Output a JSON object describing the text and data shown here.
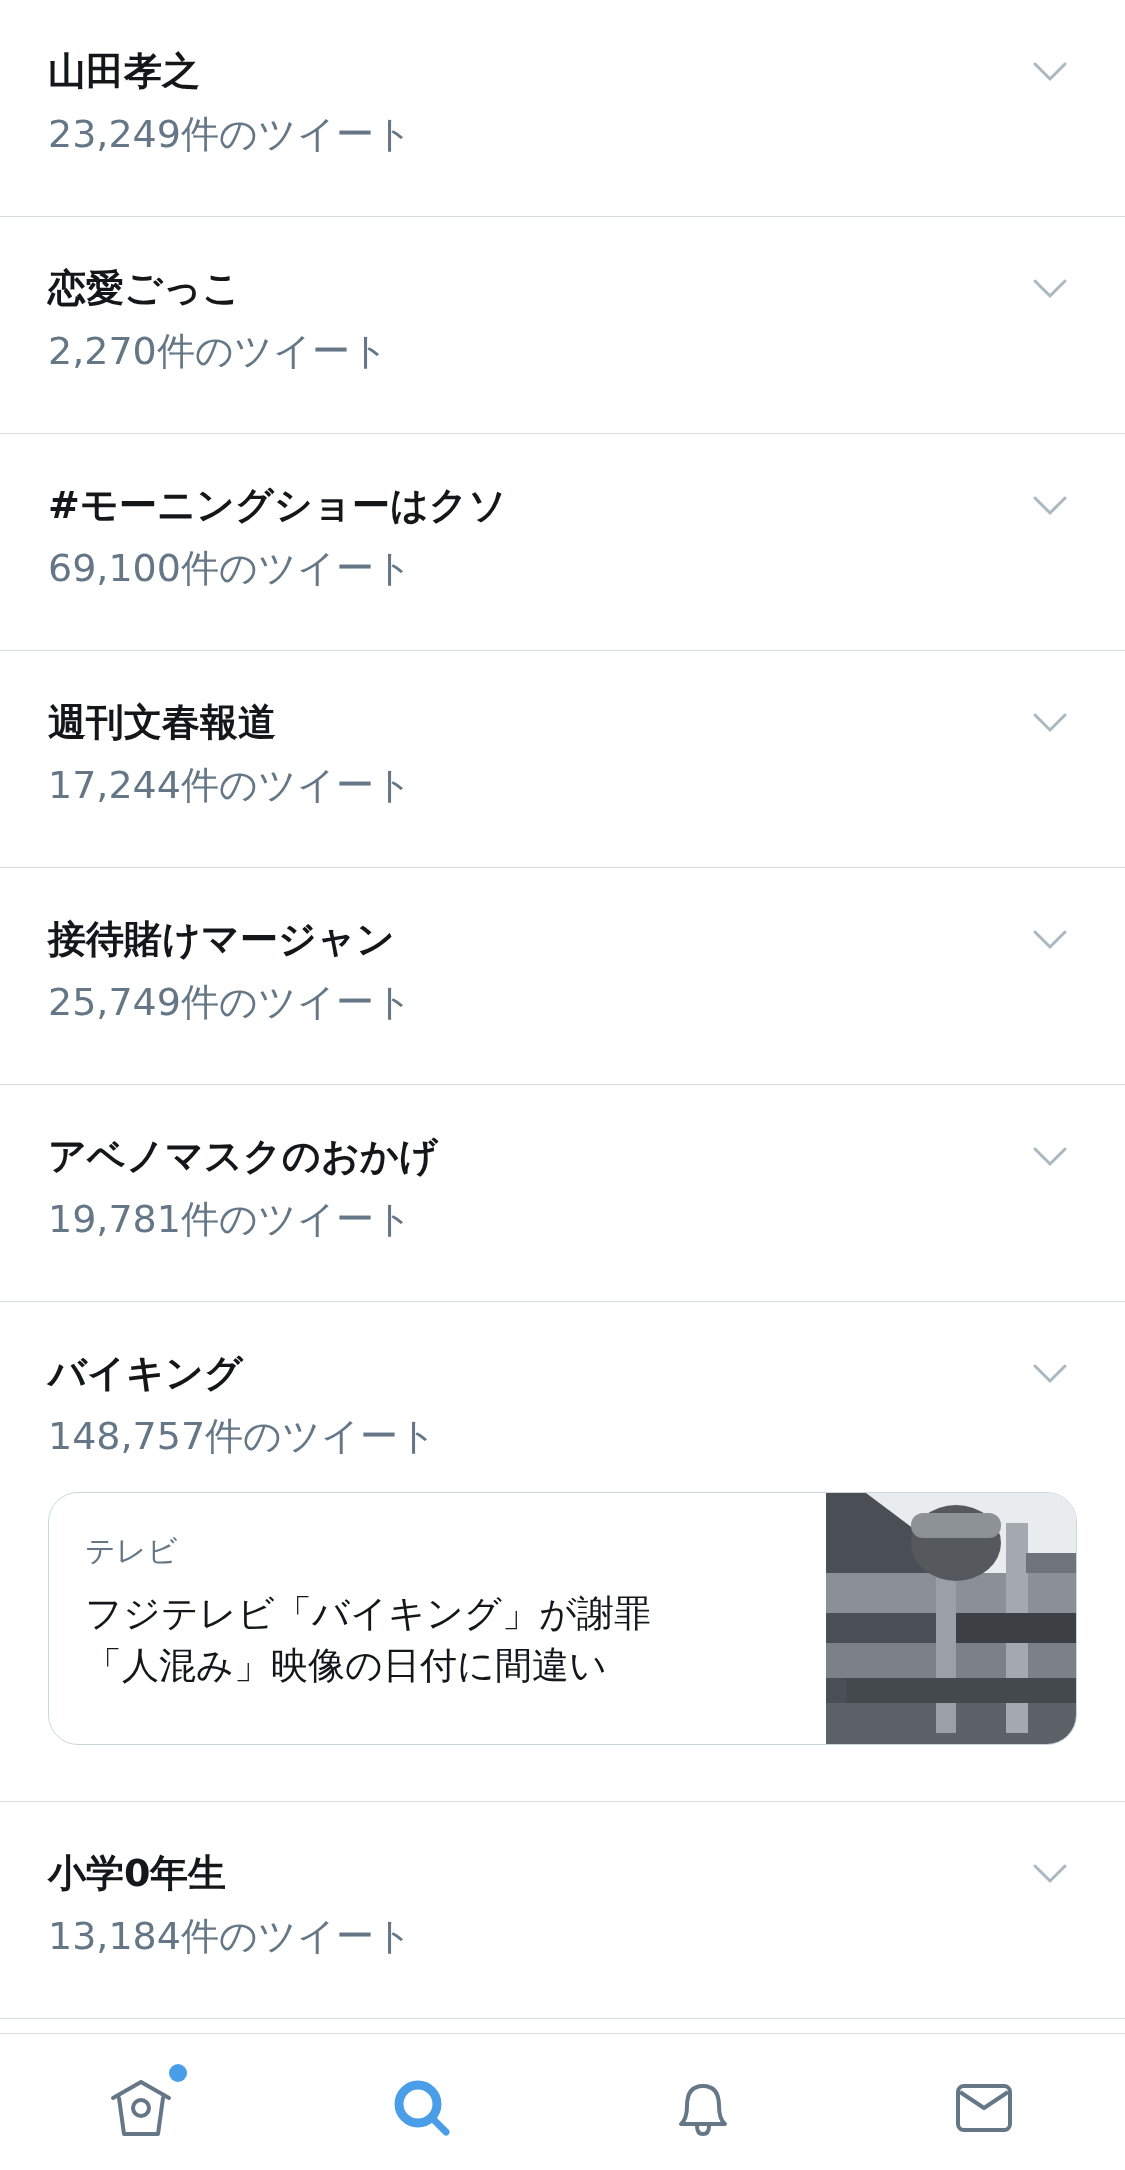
{
  "trends": [
    {
      "title": "山田孝之",
      "count": "23,249件のツイート"
    },
    {
      "title": "恋愛ごっこ",
      "count": "2,270件のツイート"
    },
    {
      "title": "#モーニングショーはクソ",
      "count": "69,100件のツイート"
    },
    {
      "title": "週刊文春報道",
      "count": "17,244件のツイート"
    },
    {
      "title": "接待賭けマージャン",
      "count": "25,749件のツイート"
    },
    {
      "title": "アベノマスクのおかげ",
      "count": "19,781件のツイート"
    },
    {
      "title": "バイキング",
      "count": "148,757件のツイート",
      "card": {
        "category": "テレビ",
        "headline_lines": [
          "フジテレビ「バイキング」が謝罪",
          "「人混み」映像の日付に間違い"
        ],
        "kind": "picture"
      }
    },
    {
      "title": "小学0年生",
      "count": "13,184件のツイート"
    }
  ],
  "tab_bar": [
    {
      "kind": "home",
      "selected": false,
      "dot": true
    },
    {
      "kind": "search",
      "selected": true,
      "dot": false
    },
    {
      "kind": "notifications",
      "selected": false,
      "dot": false
    },
    {
      "kind": "messages",
      "selected": false,
      "dot": false
    }
  ]
}
